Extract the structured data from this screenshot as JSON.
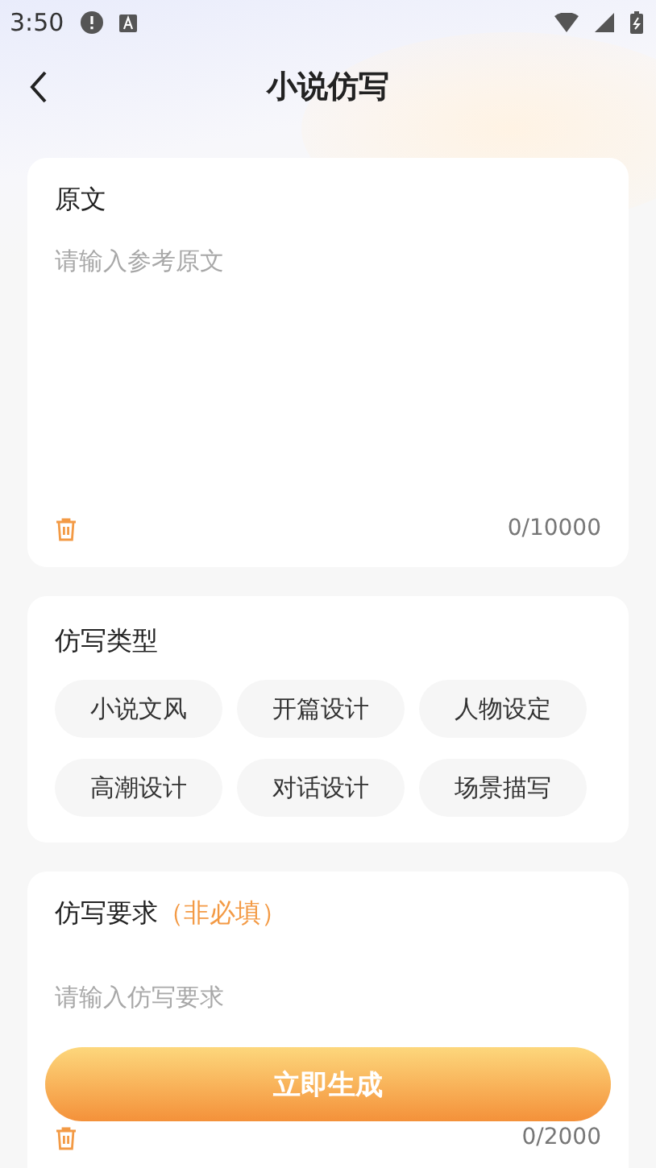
{
  "status_bar": {
    "time": "3:50"
  },
  "header": {
    "title": "小说仿写"
  },
  "source": {
    "label": "原文",
    "placeholder": "请输入参考原文",
    "counter": "0/10000"
  },
  "types": {
    "label": "仿写类型",
    "options": [
      {
        "label": "小说文风"
      },
      {
        "label": "开篇设计"
      },
      {
        "label": "人物设定"
      },
      {
        "label": "高潮设计"
      },
      {
        "label": "对话设计"
      },
      {
        "label": "场景描写"
      }
    ]
  },
  "requirements": {
    "label": "仿写要求",
    "note": "（非必填）",
    "placeholder": "请输入仿写要求",
    "counter": "0/2000"
  },
  "generate_button": "立即生成"
}
